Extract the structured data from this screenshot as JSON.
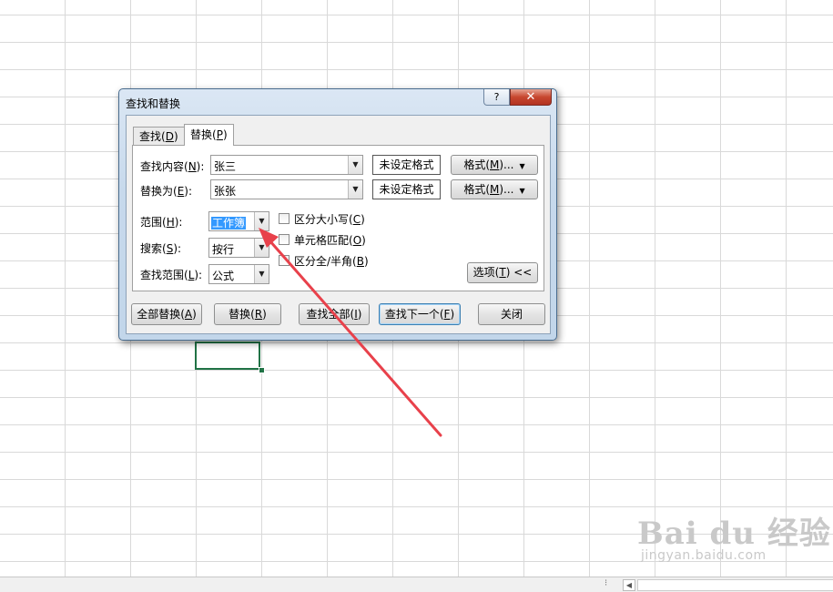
{
  "dialog": {
    "title": "查找和替换",
    "help_label": "?",
    "close_label": "✕",
    "tabs": [
      {
        "text": "查找(",
        "key": "D",
        "end": ")"
      },
      {
        "text": "替换(",
        "key": "P",
        "end": ")"
      }
    ],
    "find": {
      "text": "查找内容(",
      "key": "N",
      "end": "):",
      "value": "张三",
      "format_status": "未设定格式",
      "format_btn": {
        "text": "格式(",
        "key": "M",
        "end": ")..."
      }
    },
    "replace": {
      "text": "替换为(",
      "key": "E",
      "end": "):",
      "value": "张张",
      "format_status": "未设定格式",
      "format_btn": {
        "text": "格式(",
        "key": "M",
        "end": ")..."
      }
    },
    "within": {
      "text": "范围(",
      "key": "H",
      "end": "):",
      "value": "工作簿"
    },
    "search": {
      "text": "搜索(",
      "key": "S",
      "end": "):",
      "value": "按行"
    },
    "look_in": {
      "text": "查找范围(",
      "key": "L",
      "end": "):",
      "value": "公式"
    },
    "options": [
      {
        "text": "区分大小写(",
        "key": "C",
        "end": ")",
        "checked": false
      },
      {
        "text": "单元格匹配(",
        "key": "O",
        "end": ")",
        "checked": false
      },
      {
        "text": "区分全/半角(",
        "key": "B",
        "end": ")",
        "checked": false
      }
    ],
    "options_btn": {
      "text": "选项(",
      "key": "T",
      "end": ") <<"
    },
    "buttons": {
      "replace_all": {
        "text": "全部替换(",
        "key": "A",
        "end": ")"
      },
      "replace": {
        "text": "替换(",
        "key": "R",
        "end": ")"
      },
      "find_all": {
        "text": "查找全部(",
        "key": "I",
        "end": ")"
      },
      "find_next": {
        "text": "查找下一个(",
        "key": "F",
        "end": ")"
      },
      "close": "关闭"
    }
  },
  "status_bar": {
    "dots": "⁝",
    "scroll_left": "◀"
  },
  "watermark": {
    "logo": "Bai du 经验",
    "url": "jingyan.baidu.com"
  },
  "colors": {
    "annotation_arrow": "#e8414b",
    "selection": "#3399ff",
    "active_cell_border": "#217346"
  },
  "icons": {
    "dropdown": "▼"
  }
}
